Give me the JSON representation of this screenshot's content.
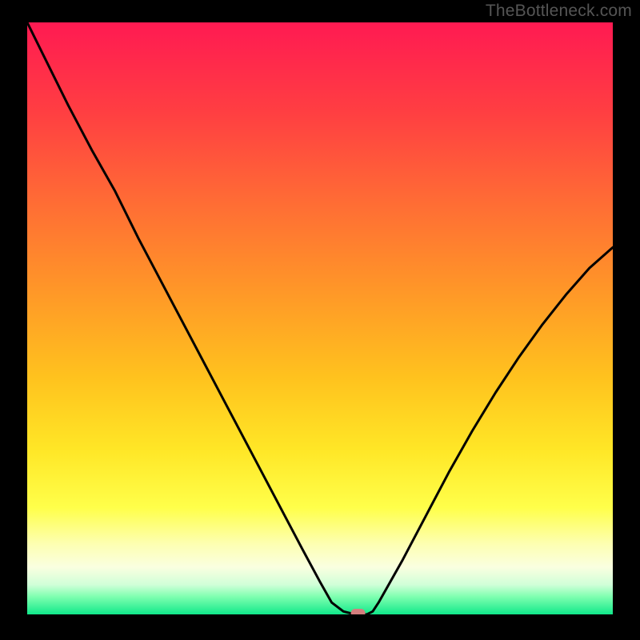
{
  "watermark": "TheBottleneck.com",
  "chart_data": {
    "type": "line",
    "title": "",
    "xlabel": "",
    "ylabel": "",
    "xlim": [
      0,
      100
    ],
    "ylim": [
      0,
      100
    ],
    "series": [
      {
        "name": "curve",
        "x": [
          0,
          3,
          7,
          11,
          15,
          19,
          23,
          27,
          31,
          35,
          39,
          43,
          47,
          50,
          52,
          54,
          56,
          58,
          59,
          60,
          64,
          68,
          72,
          76,
          80,
          84,
          88,
          92,
          96,
          100
        ],
        "y": [
          100,
          94,
          86,
          78.5,
          71.5,
          63.5,
          56,
          48.5,
          41,
          33.5,
          26,
          18.5,
          11,
          5.5,
          2,
          0.5,
          0,
          0,
          0.5,
          2,
          9,
          16.5,
          24,
          31,
          37.5,
          43.5,
          49,
          54,
          58.5,
          62
        ]
      }
    ],
    "marker": {
      "x": 56.5,
      "y": 0
    },
    "gradient_stops": [
      {
        "offset": 0,
        "color": "#ff1a52"
      },
      {
        "offset": 15,
        "color": "#ff3e42"
      },
      {
        "offset": 30,
        "color": "#ff6b35"
      },
      {
        "offset": 45,
        "color": "#ff9628"
      },
      {
        "offset": 60,
        "color": "#ffc21e"
      },
      {
        "offset": 72,
        "color": "#ffe626"
      },
      {
        "offset": 82,
        "color": "#ffff4a"
      },
      {
        "offset": 88,
        "color": "#fdffb0"
      },
      {
        "offset": 92,
        "color": "#faffe0"
      },
      {
        "offset": 95,
        "color": "#d0ffd8"
      },
      {
        "offset": 97,
        "color": "#7fffb0"
      },
      {
        "offset": 100,
        "color": "#11e88a"
      }
    ]
  }
}
